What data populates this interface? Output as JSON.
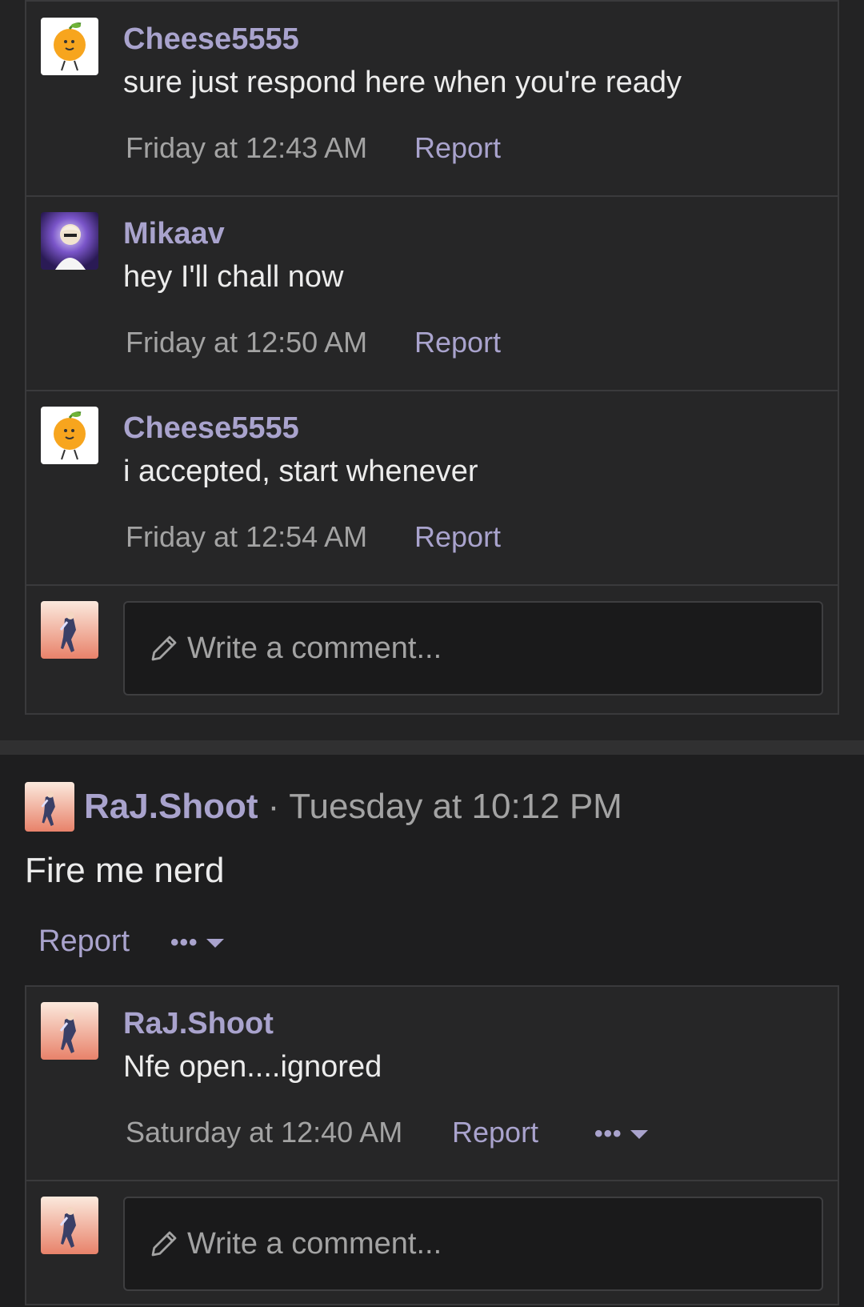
{
  "thread_comments": [
    {
      "author": "Cheese5555",
      "text": "sure just respond here when you're ready",
      "time": "Friday at 12:43 AM",
      "report": "Report",
      "avatar": "orange-character-avatar"
    },
    {
      "author": "Mikaav",
      "text": "hey I'll chall now",
      "time": "Friday at 12:50 AM",
      "report": "Report",
      "avatar": "anime-character-avatar"
    },
    {
      "author": "Cheese5555",
      "text": "i accepted, start whenever",
      "time": "Friday at 12:54 AM",
      "report": "Report",
      "avatar": "orange-character-avatar"
    }
  ],
  "write_comment": {
    "placeholder": "Write a comment...",
    "icon": "pencil-icon"
  },
  "post": {
    "author": "RaJ.Shoot",
    "separator": "·",
    "time": "Tuesday at 10:12 PM",
    "text": "Fire me nerd",
    "report": "Report",
    "more": "•••"
  },
  "post_comments": [
    {
      "author": "RaJ.Shoot",
      "text": "Nfe open....ignored",
      "time": "Saturday at 12:40 AM",
      "report": "Report",
      "more": "•••"
    }
  ],
  "colors": {
    "background": "#1e1e1f",
    "card": "#262627",
    "accent_link": "#a9a3cd",
    "muted_text": "#a3a3a3"
  }
}
